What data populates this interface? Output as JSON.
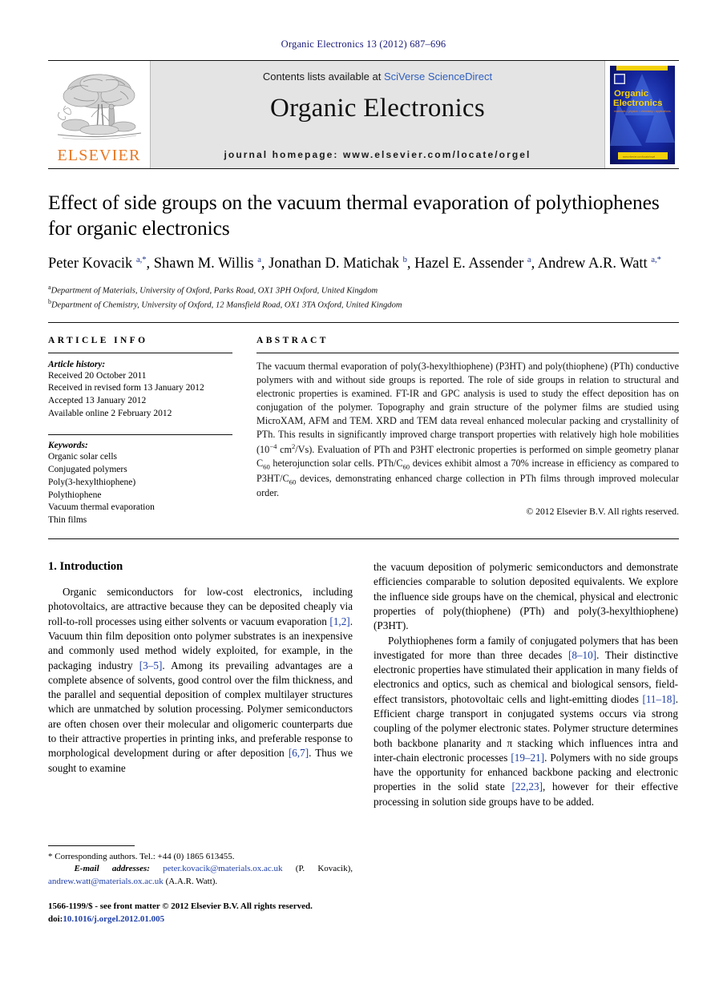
{
  "running_head": "Organic Electronics 13 (2012) 687–696",
  "masthead": {
    "elsevier_wordmark": "ELSEVIER",
    "contents_prefix": "Contents lists available at ",
    "contents_link": "SciVerse ScienceDirect",
    "journal_title": "Organic Electronics",
    "homepage": "journal homepage: www.elsevier.com/locate/orgel",
    "cover": {
      "line1": "Organic",
      "line2": "Electronics",
      "tagline": "materials • physics • chemistry • applications"
    }
  },
  "article": {
    "title": "Effect of side groups on the vacuum thermal evaporation of polythiophenes for organic electronics",
    "authors_html": "Peter Kovacik <sup>a,*</sup>, Shawn M. Willis <sup>a</sup>, Jonathan D. Matichak <sup>b</sup>, Hazel E. Assender <sup>a</sup>, Andrew A.R. Watt <sup>a,*</sup>",
    "affiliations": [
      "Department of Materials, University of Oxford, Parks Road, OX1 3PH Oxford, United Kingdom",
      "Department of Chemistry, University of Oxford, 12 Mansfield Road, OX1 3TA Oxford, United Kingdom"
    ],
    "affiliation_marks": [
      "a",
      "b"
    ]
  },
  "article_info": {
    "heading": "ARTICLE INFO",
    "history_label": "Article history:",
    "history": [
      "Received 20 October 2011",
      "Received in revised form 13 January 2012",
      "Accepted 13 January 2012",
      "Available online 2 February 2012"
    ],
    "keywords_label": "Keywords:",
    "keywords": [
      "Organic solar cells",
      "Conjugated polymers",
      "Poly(3-hexylthiophene)",
      "Polythiophene",
      "Vacuum thermal evaporation",
      "Thin films"
    ]
  },
  "abstract": {
    "heading": "ABSTRACT",
    "part1": "The vacuum thermal evaporation of poly(3-hexylthiophene) (P3HT) and poly(thiophene) (PTh) conductive polymers with and without side groups is reported. The role of side groups in relation to structural and electronic properties is examined. FT-IR and GPC analysis is used to study the effect deposition has on conjugation of the polymer. Topography and grain structure of the polymer films are studied using MicroXAM, AFM and TEM. XRD and TEM data reveal enhanced molecular packing and crystallinity of PTh. This results in significantly improved charge transport properties with relatively high hole mobilities (10",
    "sup1": "−4",
    "part2": " cm",
    "sup2": "2",
    "part3": "/Vs). Evaluation of PTh and P3HT electronic properties is performed on simple geometry planar C",
    "sub1": "60",
    "part4": " heterojunction solar cells. PTh/C",
    "sub2": "60",
    "part5": " devices exhibit almost a 70% increase in efficiency as compared to P3HT/C",
    "sub3": "60",
    "part6": " devices, demonstrating enhanced charge collection in PTh films through improved molecular order.",
    "copyright": "© 2012 Elsevier B.V. All rights reserved."
  },
  "introduction": {
    "heading": "1. Introduction",
    "left_para1_a": "Organic semiconductors for low-cost electronics, including photovoltaics, are attractive because they can be deposited cheaply via roll-to-roll processes using either solvents or vacuum evaporation ",
    "left_ref1": "[1,2]",
    "left_para1_b": ". Vacuum thin film deposition onto polymer substrates is an inexpensive and commonly used method widely exploited, for example, in the packaging industry ",
    "left_ref2": "[3–5]",
    "left_para1_c": ". Among its prevailing advantages are a complete absence of solvents, good control over the film thickness, and the parallel and sequential deposition of complex multilayer structures which are unmatched by solution processing. Polymer semiconductors are often chosen over their molecular and oligomeric counterparts due to their attractive properties in printing inks, and preferable response to morphological development during or after deposition ",
    "left_ref3": "[6,7]",
    "left_para1_d": ". Thus we sought to examine",
    "right_para1": "the vacuum deposition of polymeric semiconductors and demonstrate efficiencies comparable to solution deposited equivalents. We explore the influence side groups have on the chemical, physical and electronic properties of poly(thiophene) (PTh) and poly(3-hexylthiophene) (P3HT).",
    "right_para2_a": "Polythiophenes form a family of conjugated polymers that has been investigated for more than three decades ",
    "right_ref1": "[8–10]",
    "right_para2_b": ". Their distinctive electronic properties have stimulated their application in many fields of electronics and optics, such as chemical and biological sensors, field-effect transistors, photovoltaic cells and light-emitting diodes ",
    "right_ref2": "[11–18]",
    "right_para2_c": ". Efficient charge transport in conjugated systems occurs via strong coupling of the polymer electronic states. Polymer structure determines both backbone planarity and π stacking which influences intra and inter-chain electronic processes ",
    "right_ref3": "[19–21]",
    "right_para2_d": ". Polymers with no side groups have the opportunity for enhanced backbone packing and electronic properties in the solid state ",
    "right_ref4": "[22,23]",
    "right_para2_e": ", however for their effective processing in solution side groups have to be added."
  },
  "footnote": {
    "corresponding": "* Corresponding authors. Tel.: +44 (0) 1865 613455.",
    "email_label": "E-mail addresses:",
    "email1": "peter.kovacik@materials.ox.ac.uk",
    "email1_name": " (P. Kovacik), ",
    "email2": "andrew.watt@materials.ox.ac.uk",
    "email2_name": " (A.A.R. Watt)."
  },
  "issn": {
    "line1": "1566-1199/$ - see front matter © 2012 Elsevier B.V. All rights reserved.",
    "doi_prefix": "doi:",
    "doi": "10.1016/j.orgel.2012.01.005"
  },
  "colors": {
    "link_blue": "#1f3fa8",
    "header_blue": "#1a1a7a",
    "elsevier_orange": "#E87722",
    "banner_grey": "#e4e4e4",
    "cover_blue": "#0a1f8f",
    "cover_yellow": "#f5d10a"
  }
}
